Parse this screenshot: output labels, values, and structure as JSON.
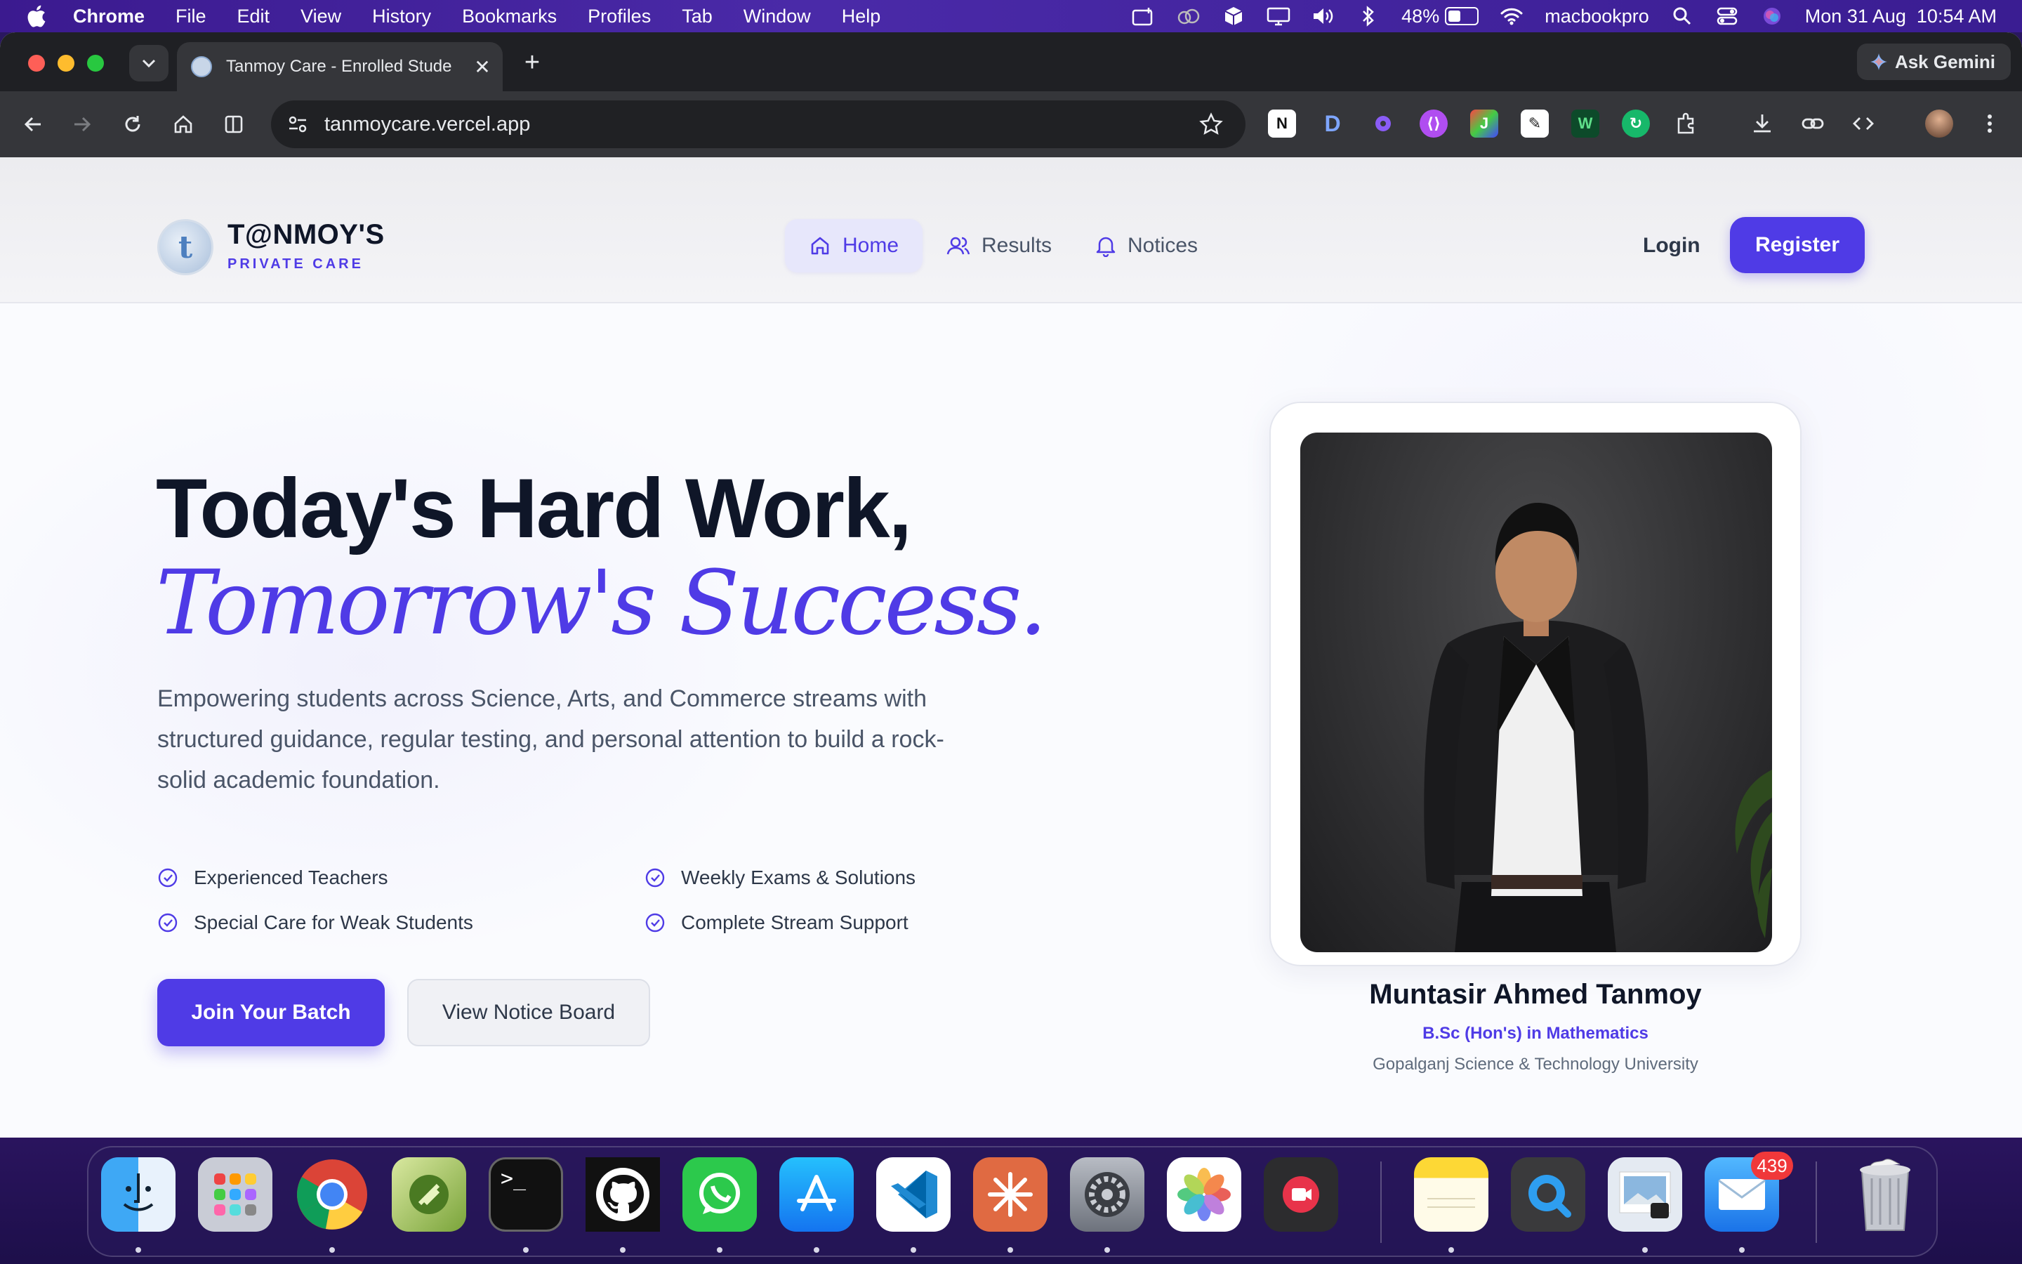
{
  "menubar": {
    "app_name": "Chrome",
    "menus": [
      "File",
      "Edit",
      "View",
      "History",
      "Bookmarks",
      "Profiles",
      "Tab",
      "Window",
      "Help"
    ],
    "battery": "48%",
    "hostname": "macbookpro",
    "datetime": "Mon 31 Aug  10:54 AM",
    "battery_level": 0.48
  },
  "browser": {
    "tab_title": "Tanmoy Care - Enrolled Stude",
    "url": "tanmoycare.vercel.app",
    "ask_gemini": "Ask Gemini",
    "new_tab": "+",
    "tab_close": "✕"
  },
  "site": {
    "brand_name": "T@NMOY'S",
    "brand_sub": "PRIVATE CARE",
    "nav": {
      "home": "Home",
      "results": "Results",
      "notices": "Notices",
      "login": "Login",
      "register": "Register"
    },
    "hero": {
      "line1": "Today's Hard Work,",
      "line2": "Tomorrow's Success.",
      "paragraph": "Empowering students across Science, Arts, and Commerce streams with structured guidance, regular testing, and personal attention to build a rock-solid academic foundation.",
      "features": [
        "Experienced Teachers",
        "Weekly Exams & Solutions",
        "Special Care for Weak Students",
        "Complete Stream Support"
      ],
      "join_button": "Join Your Batch",
      "notice_button": "View Notice Board"
    },
    "profile": {
      "name": "Muntasir Ahmed Tanmoy",
      "degree": "B.Sc (Hon's) in Mathematics",
      "university": "Gopalganj Science & Technology University"
    }
  },
  "dock": {
    "apps": [
      "finder",
      "launchpad",
      "chrome",
      "rocket",
      "terminal",
      "github",
      "whatsapp",
      "app-store",
      "vscode",
      "claude",
      "system-settings",
      "photos",
      "screen-recorder",
      "notes",
      "quicktime",
      "preview",
      "mail",
      "trash"
    ],
    "mail_badge": "439"
  },
  "colors": {
    "accent": "#4f3be6",
    "heading": "#0f1628"
  }
}
